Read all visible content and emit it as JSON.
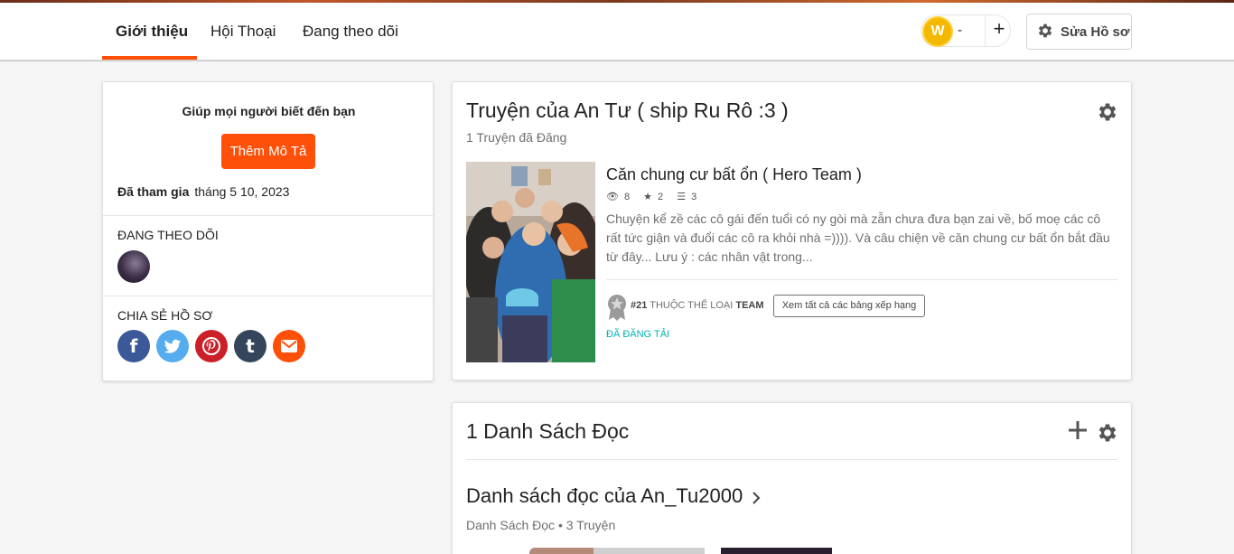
{
  "tabs": [
    {
      "label": "Giới thiệu",
      "active": true
    },
    {
      "label": "Hội Thoại",
      "active": false
    },
    {
      "label": "Đang theo dõi",
      "active": false
    }
  ],
  "coins": {
    "icon": "w-coin-icon",
    "count": "-",
    "add_label": "+"
  },
  "edit_profile": {
    "label": "Sửa Hồ sơ",
    "icon": "gear-icon"
  },
  "about": {
    "prompt": "Giúp mọi người biết đến bạn",
    "add_description": "Thêm Mô Tả",
    "joined_label": "Đã tham gia",
    "joined_date": "tháng 5 10, 2023",
    "following_label": "ĐANG THEO DÕI",
    "share_label": "CHIA SẺ HỒ SƠ",
    "share_buttons": [
      {
        "icon": "facebook-icon",
        "glyph": "f",
        "color": "#3b5998"
      },
      {
        "icon": "twitter-icon",
        "glyph": "t",
        "color": "#55acee"
      },
      {
        "icon": "pinterest-icon",
        "glyph": "p",
        "color": "#cb2027"
      },
      {
        "icon": "tumblr-icon",
        "glyph": "t",
        "color": "#35465c"
      },
      {
        "icon": "email-icon",
        "glyph": "✉",
        "color": "#ff500a"
      }
    ]
  },
  "stories": {
    "title": "Truyện của An Tư ( ship Ru Rô :3 )",
    "subtitle": "1 Truyện đã Đăng",
    "story": {
      "title": "Căn chung cư bất ổn ( Hero Team )",
      "views": "8",
      "votes": "2",
      "parts": "3",
      "description": "Chuyện kể zề các cô gái đến tuổi có ny gòi mà zẫn chưa đưa bạn zai về, bố moẹ các cô rất tức giận và đuổi các cô ra khỏi nhà =)))). Và câu chiện về căn chung cư bất ổn bắt đầu từ đây... Lưu ý : các nhân vật trong...",
      "rank_hash": "#21",
      "rank_text": "THUỘC THỂ LOẠI",
      "rank_tag": "TEAM",
      "rankings_button": "Xem tất cả các bảng xếp hạng",
      "status": "ĐÃ ĐĂNG TẢI"
    }
  },
  "reading_lists": {
    "title": "1 Danh Sách Đọc",
    "list_name": "Danh sách đọc của An_Tu2000",
    "list_type": "Danh Sách Đọc",
    "list_count": "3 Truyện"
  }
}
